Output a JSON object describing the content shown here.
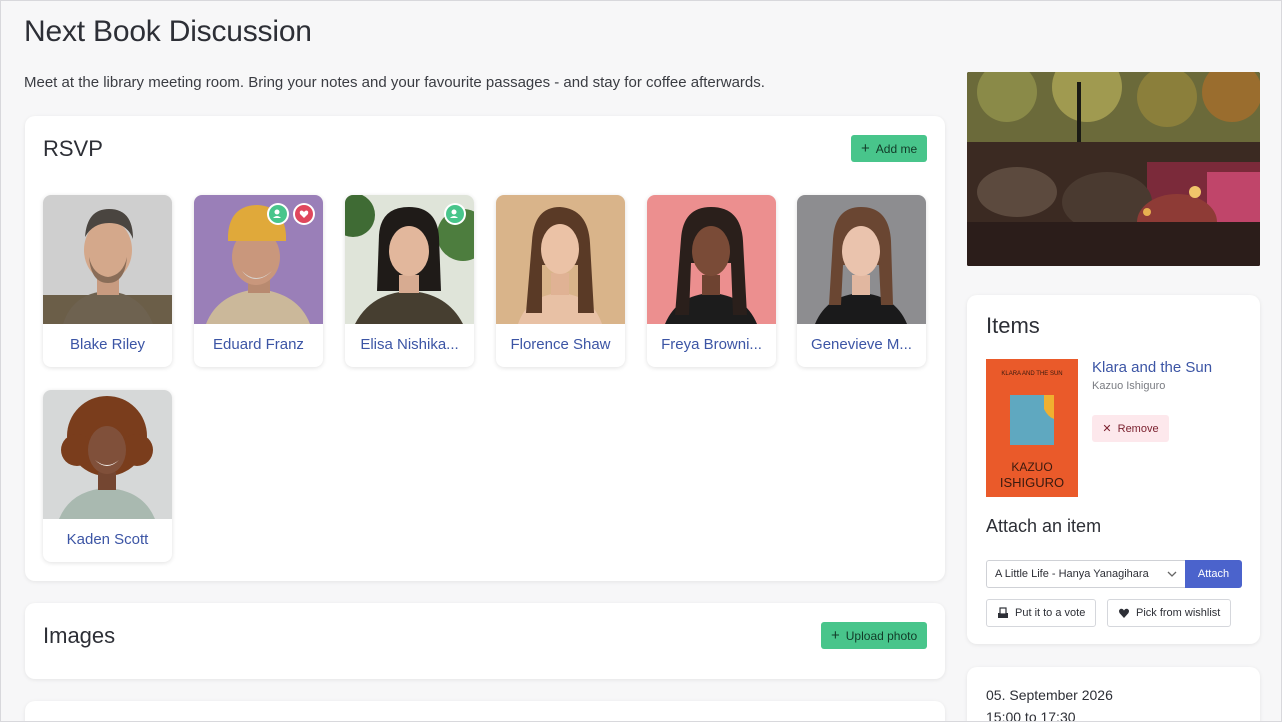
{
  "event": {
    "title": "Next Book Discussion",
    "description": "Meet at the library meeting room. Bring your notes and your favourite passages - and stay for coffee afterwards."
  },
  "rsvp": {
    "title": "RSVP",
    "add_label": "Add me",
    "people": [
      {
        "name": "Blake Riley"
      },
      {
        "name": "Eduard Franz"
      },
      {
        "name": "Elisa Nishika..."
      },
      {
        "name": "Florence Shaw"
      },
      {
        "name": "Freya Browni..."
      },
      {
        "name": "Genevieve M..."
      },
      {
        "name": "Kaden Scott"
      }
    ]
  },
  "images": {
    "title": "Images",
    "upload_label": "Upload photo"
  },
  "items": {
    "title": "Items",
    "book": {
      "title": "Klara and the Sun",
      "author": "Kazuo Ishiguro",
      "cover_top": "KLARA AND THE SUN",
      "cover_author_1": "KAZUO",
      "cover_author_2": "ISHIGURO"
    },
    "remove_label": "Remove"
  },
  "attach": {
    "title": "Attach an item",
    "selected": "A Little Life - Hanya Yanagihara",
    "attach_label": "Attach",
    "vote_label": "Put it to a vote",
    "wishlist_label": "Pick from wishlist"
  },
  "schedule": {
    "date": "05. September 2026",
    "time": "15:00 to 17:30"
  },
  "colors": {
    "accent_green": "#48c58b",
    "accent_blue": "#4b63cc",
    "link_blue": "#3c55a5",
    "remove_bg": "#fde8ec"
  }
}
